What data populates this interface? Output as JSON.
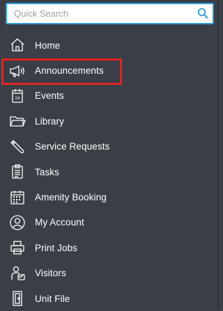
{
  "search": {
    "placeholder": "Quick Search"
  },
  "nav": {
    "items": [
      {
        "label": "Home",
        "icon": "home-icon"
      },
      {
        "label": "Announcements",
        "icon": "megaphone-icon"
      },
      {
        "label": "Events",
        "icon": "calendar-icon"
      },
      {
        "label": "Library",
        "icon": "folder-icon"
      },
      {
        "label": "Service Requests",
        "icon": "wrench-icon"
      },
      {
        "label": "Tasks",
        "icon": "clipboard-icon"
      },
      {
        "label": "Amenity Booking",
        "icon": "calendar-grid-icon"
      },
      {
        "label": "My Account",
        "icon": "user-circle-icon"
      },
      {
        "label": "Print Jobs",
        "icon": "printer-icon"
      },
      {
        "label": "Visitors",
        "icon": "visitors-icon"
      },
      {
        "label": "Unit File",
        "icon": "door-icon"
      }
    ],
    "highlighted_index": 1
  },
  "colors": {
    "sidebar_bg": "#3a3f47",
    "search_border": "#2f9bd6",
    "highlight": "#e02424",
    "text": "#ffffff"
  }
}
